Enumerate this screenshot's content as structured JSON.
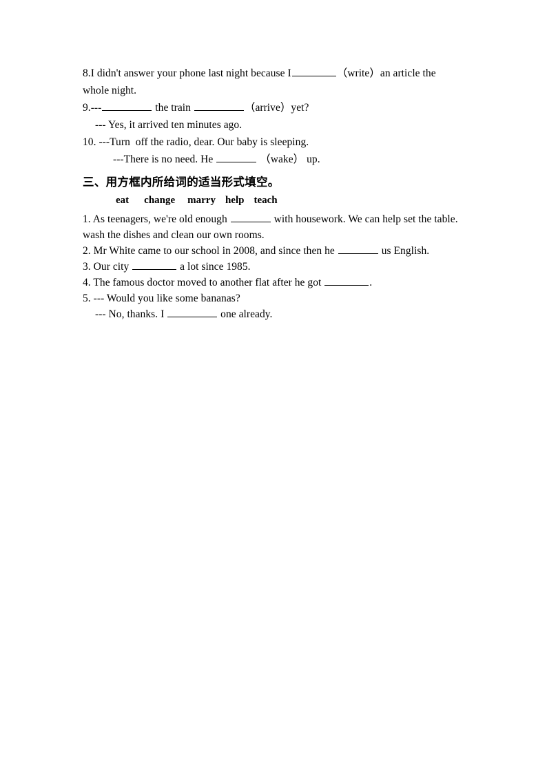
{
  "document": {
    "page_background": "#ffffff",
    "text_color": "#000000"
  },
  "section_a": {
    "lines": [
      {
        "id": "q8a",
        "pre": "8.I didn't answer your phone last night because I",
        "blank": "b-md",
        "post": "（write）an article the"
      },
      {
        "id": "q8b",
        "pre": "whole night.",
        "blank": "",
        "post": ""
      },
      {
        "id": "q9a_pre",
        "pre": "9.---",
        "blank": "b-lg",
        "mid": " the train ",
        "blank2": "b-lg",
        "post": "（arrive）yet?"
      },
      {
        "id": "q9b",
        "pre": "--- Yes, it arrived ten minutes ago.",
        "blank": "",
        "post": ""
      },
      {
        "id": "q10a",
        "pre": "10. ---Turn  off the radio, dear. Our baby is sleeping.",
        "blank": "",
        "post": ""
      },
      {
        "id": "q10b",
        "pre": "---There is no need. He ",
        "blank": "b-sm",
        "post": " （wake） up."
      }
    ],
    "q8_text_pre": "8.I didn't answer your phone last night because I",
    "q8_text_post": "（write）an article the",
    "q8_line2": "whole night.",
    "q9_num": "9.---",
    "q9_mid": " the train ",
    "q9_post": "（arrive）yet?",
    "q9_answer": "--- Yes, it arrived ten minutes ago.",
    "q10_line1": "10. ---Turn  off the radio, dear. Our baby is sleeping.",
    "q10_line2_pre": "---There is no need. He ",
    "q10_line2_post": " （wake） up."
  },
  "section_b": {
    "heading": "三、用方框内所给词的适当形式填空。",
    "word_bank": [
      "eat",
      "change",
      "marry",
      "help",
      "teach"
    ]
  },
  "section_c": {
    "q1_line1_pre": "1. As teenagers, we're old enough ",
    "q1_line1_post": " with housework. We can help set the table.",
    "q1_line2": "wash the dishes and clean our own rooms.",
    "q2_pre": "2. Mr White came to our school in 2008, and since then he ",
    "q2_post": " us English.",
    "q3_pre": "3. Our city ",
    "q3_post": " a lot since 1985.",
    "q4_pre": "4. The famous doctor moved to another flat after he got ",
    "q4_post": ".",
    "q5_line1": "5. --- Would you like some bananas?",
    "q5_line2_pre": "--- No, thanks. I ",
    "q5_line2_post": " one already."
  }
}
